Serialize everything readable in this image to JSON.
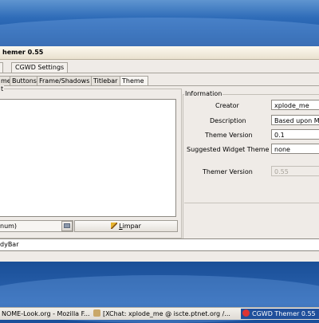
{
  "window": {
    "title": "hemer 0.55",
    "outer_tabs": [
      "CGWD Settings"
    ],
    "inner_tabs": [
      "me",
      "Buttons",
      "Frame/Shadows",
      "Titlebar",
      "Theme"
    ],
    "active_inner_tab": "Theme"
  },
  "left_panel": {
    "frame_title": "t",
    "combo_value": "num)",
    "clear_button": {
      "prefix": "L",
      "accel": "",
      "label_rest": "impar",
      "full": "Limpar"
    }
  },
  "info_panel": {
    "title": "Information",
    "creator_label": "Creator",
    "creator_value": "xplode_me",
    "description_label": "Description",
    "description_value": "Based upon M",
    "theme_version_label": "Theme Version",
    "theme_version_value": "0.1",
    "suggested_widget_label": "Suggested Widget Theme",
    "suggested_widget_value": "none",
    "themer_version_label": "Themer Version",
    "themer_version_value": "0.55"
  },
  "statusbar": {
    "text": "dyBar"
  },
  "taskbar": {
    "items": [
      {
        "label": "NOME-Look.org - Mozilla F..."
      },
      {
        "label": "[XChat: xplode_me @ iscte.ptnet.org /..."
      },
      {
        "label": "CGWD Themer 0.55"
      }
    ],
    "colors": {
      "active": "#1f4f9b"
    }
  }
}
